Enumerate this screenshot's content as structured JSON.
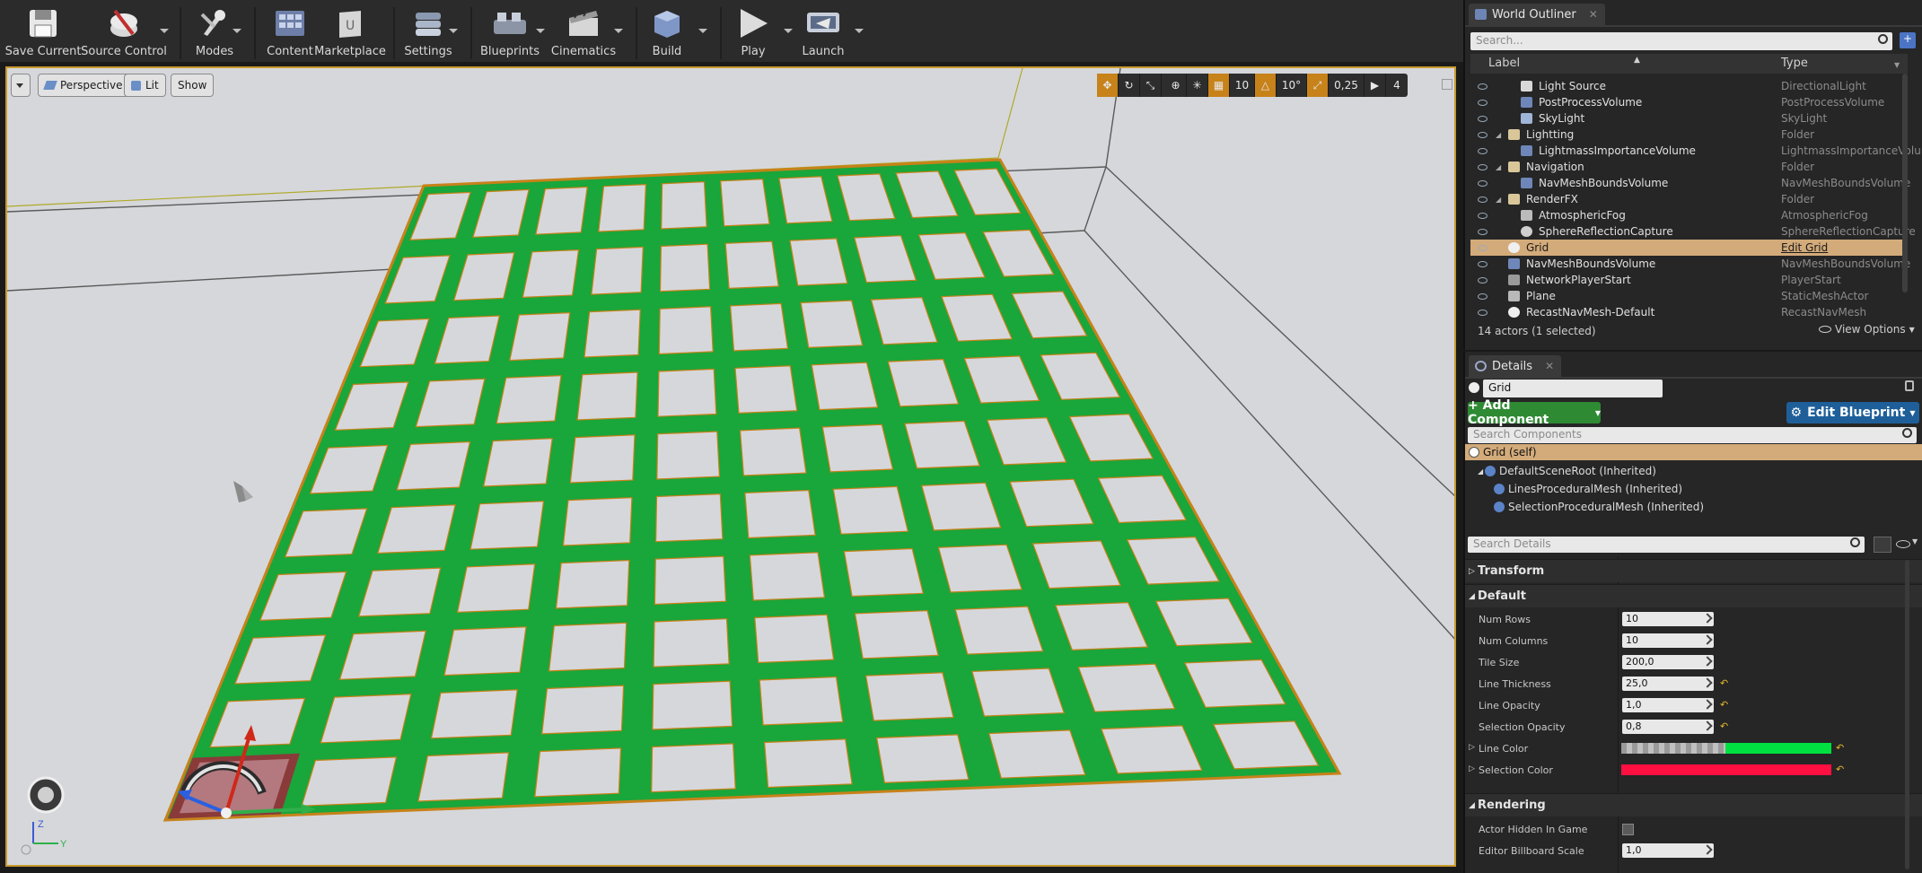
{
  "toolbar": {
    "items": [
      {
        "label": "Save Current",
        "icon": "save-icon"
      },
      {
        "label": "Source Control",
        "icon": "source-control-icon"
      },
      {
        "label": "Modes",
        "icon": "modes-icon"
      },
      {
        "label": "Content",
        "icon": "content-icon"
      },
      {
        "label": "Marketplace",
        "icon": "marketplace-icon"
      },
      {
        "label": "Settings",
        "icon": "settings-icon"
      },
      {
        "label": "Blueprints",
        "icon": "blueprints-icon"
      },
      {
        "label": "Cinematics",
        "icon": "cinematics-icon"
      },
      {
        "label": "Build",
        "icon": "build-icon"
      },
      {
        "label": "Play",
        "icon": "play-icon"
      },
      {
        "label": "Launch",
        "icon": "launch-icon"
      }
    ]
  },
  "viewport": {
    "perspective_label": "Perspective",
    "lit_label": "Lit",
    "show_label": "Show",
    "grid_snap": "10",
    "rotation_snap": "10°",
    "scale_snap": "0,25",
    "camera_speed": "4",
    "axis_z": "Z",
    "axis_y": "Y",
    "grid_rows": 10,
    "grid_cols": 10,
    "selected_tile": [
      0,
      0
    ],
    "colors": {
      "line": "#19a63a",
      "selection": "#b3797f",
      "border": "#c7821a",
      "background": "#d6d7db"
    }
  },
  "outliner": {
    "title": "World Outliner",
    "search_placeholder": "Search...",
    "col_label": "Label",
    "col_type": "Type",
    "rows": [
      {
        "name": "Light Source",
        "type": "DirectionalLight",
        "indent": 2,
        "icon": "light-icon"
      },
      {
        "name": "PostProcessVolume",
        "type": "PostProcessVolume",
        "indent": 2,
        "icon": "volume-icon"
      },
      {
        "name": "SkyLight",
        "type": "SkyLight",
        "indent": 2,
        "icon": "skylight-icon"
      },
      {
        "name": "Lightting",
        "type": "Folder",
        "indent": 1,
        "icon": "folder-icon"
      },
      {
        "name": "LightmassImportanceVolume",
        "type": "LightmassImportanceVolume",
        "indent": 2,
        "icon": "volume-icon"
      },
      {
        "name": "Navigation",
        "type": "Folder",
        "indent": 1,
        "icon": "folder-icon"
      },
      {
        "name": "NavMeshBoundsVolume",
        "type": "NavMeshBoundsVolume",
        "indent": 2,
        "icon": "volume-icon"
      },
      {
        "name": "RenderFX",
        "type": "Folder",
        "indent": 1,
        "icon": "folder-icon"
      },
      {
        "name": "AtmosphericFog",
        "type": "AtmosphericFog",
        "indent": 2,
        "icon": "fog-icon"
      },
      {
        "name": "SphereReflectionCapture",
        "type": "SphereReflectionCapture",
        "indent": 2,
        "icon": "sphere-icon"
      },
      {
        "name": "Grid",
        "type": "Edit Grid",
        "indent": 1,
        "icon": "actor-icon",
        "selected": true
      },
      {
        "name": "NavMeshBoundsVolume",
        "type": "NavMeshBoundsVolume",
        "indent": 1,
        "icon": "volume-icon"
      },
      {
        "name": "NetworkPlayerStart",
        "type": "PlayerStart",
        "indent": 1,
        "icon": "player-start-icon"
      },
      {
        "name": "Plane",
        "type": "StaticMeshActor",
        "indent": 1,
        "icon": "mesh-icon"
      },
      {
        "name": "RecastNavMesh-Default",
        "type": "RecastNavMesh",
        "indent": 1,
        "icon": "actor-icon"
      }
    ],
    "status": "14 actors (1 selected)",
    "view_options": "View Options"
  },
  "details": {
    "title": "Details",
    "name_value": "Grid",
    "add_component": "+ Add Component",
    "edit_blueprint": "Edit Blueprint",
    "search_components_placeholder": "Search Components",
    "self_label": "Grid (self)",
    "components": [
      "DefaultSceneRoot (Inherited)",
      "LinesProceduralMesh (Inherited)",
      "SelectionProceduralMesh (Inherited)"
    ],
    "search_details_placeholder": "Search Details",
    "sections": {
      "transform": "Transform",
      "default": "Default",
      "rendering": "Rendering"
    },
    "props": [
      {
        "label": "Num Rows",
        "value": "10",
        "reset": false
      },
      {
        "label": "Num Columns",
        "value": "10",
        "reset": false
      },
      {
        "label": "Tile Size",
        "value": "200,0",
        "reset": false
      },
      {
        "label": "Line Thickness",
        "value": "25,0",
        "reset": true
      },
      {
        "label": "Line Opacity",
        "value": "1,0",
        "reset": true
      },
      {
        "label": "Selection Opacity",
        "value": "0,8",
        "reset": true
      }
    ],
    "line_color_label": "Line Color",
    "line_color": "#00e040",
    "selection_color_label": "Selection Color",
    "selection_color": "#ff1040",
    "actor_hidden_label": "Actor Hidden In Game",
    "billboard_scale_label": "Editor Billboard Scale",
    "billboard_scale_value": "1,0"
  }
}
